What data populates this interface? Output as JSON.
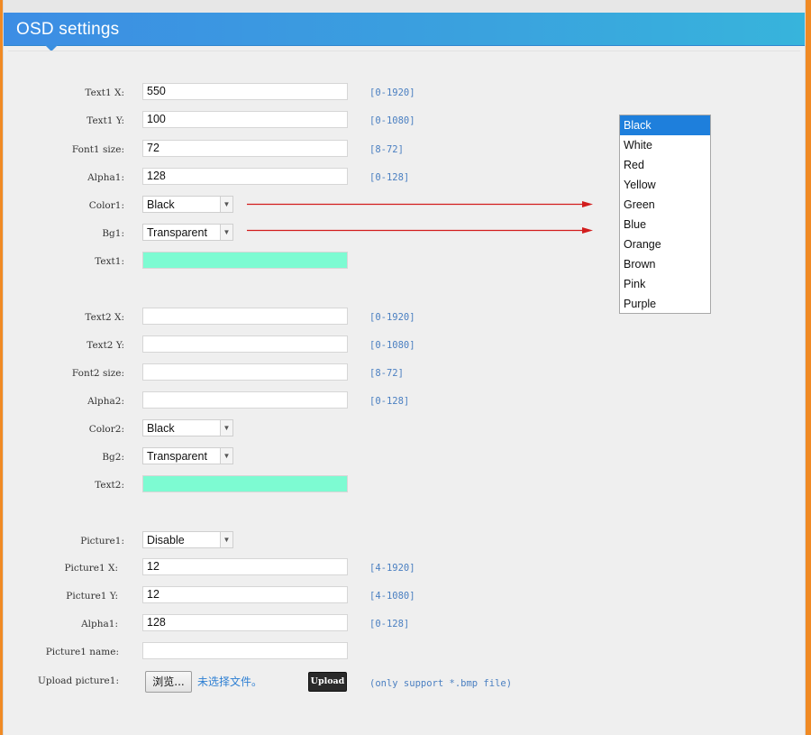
{
  "header": {
    "title": "OSD settings"
  },
  "section1": {
    "text_x": {
      "label": "Text1 X:",
      "value": "550",
      "range": "[0-1920]"
    },
    "text_y": {
      "label": "Text1 Y:",
      "value": "100",
      "range": "[0-1080]"
    },
    "font_size": {
      "label": "Font1 size:",
      "value": "72",
      "range": "[8-72]"
    },
    "alpha": {
      "label": "Alpha1:",
      "value": "128",
      "range": "[0-128]"
    },
    "color": {
      "label": "Color1:",
      "value": "Black"
    },
    "bg": {
      "label": "Bg1:",
      "value": "Transparent"
    },
    "text": {
      "label": "Text1:",
      "value": ""
    }
  },
  "section2": {
    "text_x": {
      "label": "Text2 X:",
      "value": "",
      "range": "[0-1920]"
    },
    "text_y": {
      "label": "Text2 Y:",
      "value": "",
      "range": "[0-1080]"
    },
    "font_size": {
      "label": "Font2 size:",
      "value": "",
      "range": "[8-72]"
    },
    "alpha": {
      "label": "Alpha2:",
      "value": "",
      "range": "[0-128]"
    },
    "color": {
      "label": "Color2:",
      "value": "Black"
    },
    "bg": {
      "label": "Bg2:",
      "value": "Transparent"
    },
    "text": {
      "label": "Text2:",
      "value": ""
    }
  },
  "picture": {
    "enable": {
      "label": "Picture1:",
      "value": "Disable"
    },
    "x": {
      "label": "Picture1 X:",
      "value": "12",
      "range": "[4-1920]"
    },
    "y": {
      "label": "Picture1 Y:",
      "value": "12",
      "range": "[4-1080]"
    },
    "alpha": {
      "label": "Alpha1:",
      "value": "128",
      "range": "[0-128]"
    },
    "name": {
      "label": "Picture1 name:",
      "value": ""
    },
    "upload": {
      "label": "Upload picture1:",
      "browse_label": "浏览...",
      "file_status": "未选择文件。",
      "upload_label": "Upload",
      "note": "(only support *.bmp file)"
    }
  },
  "color_dropdown": {
    "selected": "Black",
    "options": [
      "Black",
      "White",
      "Red",
      "Yellow",
      "Green",
      "Blue",
      "Orange",
      "Brown",
      "Pink",
      "Purple"
    ]
  },
  "colors": {
    "title_bar": "#3a9be0",
    "preview_fill": "#7dfbd2",
    "range_text": "#4a7fc1",
    "arrow": "#d21d1d",
    "dropdown_selected": "#1e7fdc",
    "outer_border": "#f08a24"
  }
}
